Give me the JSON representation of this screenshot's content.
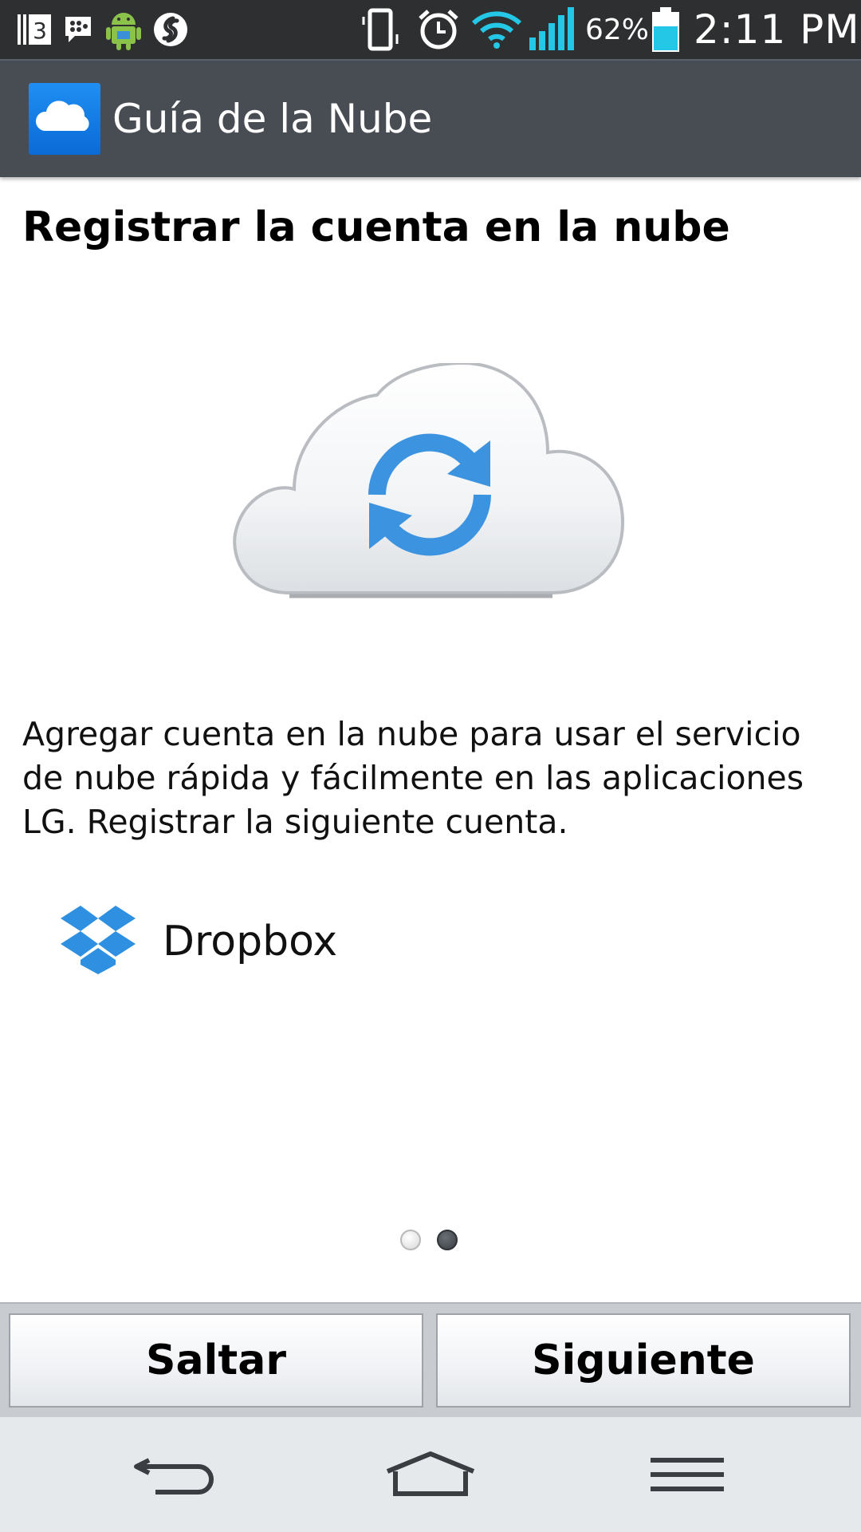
{
  "status_bar": {
    "notification_icons": [
      "notification-count-icon",
      "bbm-icon",
      "android-debug-icon",
      "shazam-icon"
    ],
    "notification_count": "3",
    "system_icons": [
      "vibrate-icon",
      "alarm-icon",
      "wifi-icon",
      "signal-icon",
      "battery-icon"
    ],
    "battery_percent": "62%",
    "time": "2:11 PM"
  },
  "action_bar": {
    "title": "Guía de la Nube",
    "icon": "cloud-app-icon"
  },
  "content": {
    "heading": "Registrar la cuenta en la nube",
    "hero_icon": "cloud-sync-icon",
    "description": "Agregar cuenta en la nube para usar el servicio de nube rápida y fácilmente en las aplicaciones LG. Registrar la siguiente cuenta.",
    "accounts": [
      {
        "label": "Dropbox",
        "icon": "dropbox-icon"
      }
    ]
  },
  "page_indicator": {
    "total": 2,
    "current": 2
  },
  "buttons": {
    "skip": "Saltar",
    "next": "Siguiente"
  },
  "nav_bar": [
    "back-icon",
    "home-icon",
    "menu-icon"
  ],
  "colors": {
    "action_bar": "#484c53",
    "status_bar": "#2d2f31",
    "accent_blue": "#2f8fe0"
  }
}
